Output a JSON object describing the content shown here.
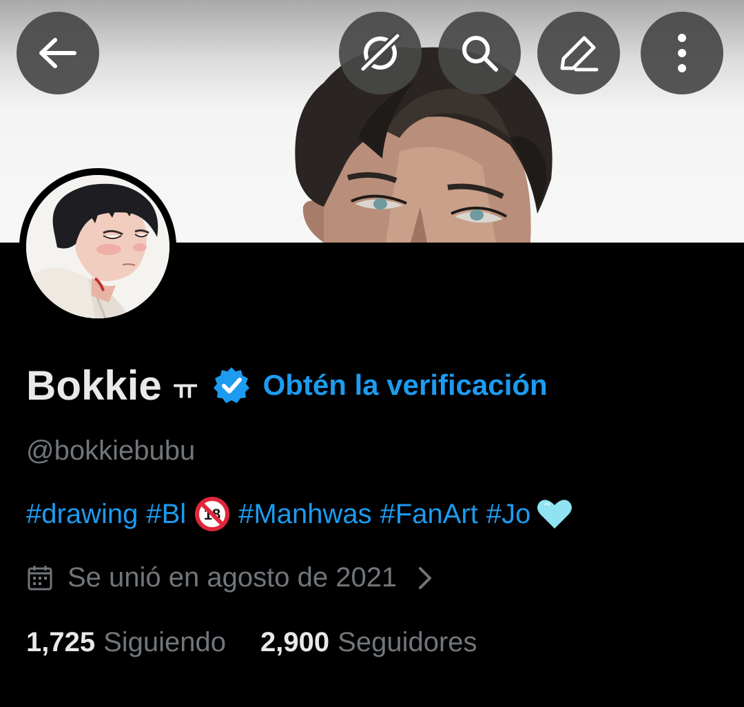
{
  "header": {
    "back_icon": "arrow-left-icon",
    "buttons": [
      {
        "name": "grok-button",
        "icon": "slash-circle-icon"
      },
      {
        "name": "search-button",
        "icon": "search-icon"
      },
      {
        "name": "edit-button",
        "icon": "pencil-icon"
      },
      {
        "name": "more-button",
        "icon": "more-vertical-icon"
      }
    ]
  },
  "profile": {
    "display_name": "Bokkie",
    "name_glyph": "ㅠ",
    "verified_icon": "verified-badge-icon",
    "get_verified_label": "Obtén la verificación",
    "handle": "@bokkiebubu",
    "bio_tags": [
      "#drawing",
      "#Bl",
      "#Manhwas",
      "#FanArt",
      "#Jo"
    ],
    "bio_emojis": [
      "no-under-18-icon",
      "light-blue-heart-icon"
    ],
    "joined_text": "Se unió en agosto de 2021",
    "following_count": "1,725",
    "following_label": "Siguiendo",
    "followers_count": "2,900",
    "followers_label": "Seguidores"
  },
  "colors": {
    "accent": "#1d9bf0",
    "background": "#000000",
    "text_primary": "#e7e9ea",
    "text_secondary": "#71767b",
    "button_bg": "#484848"
  }
}
